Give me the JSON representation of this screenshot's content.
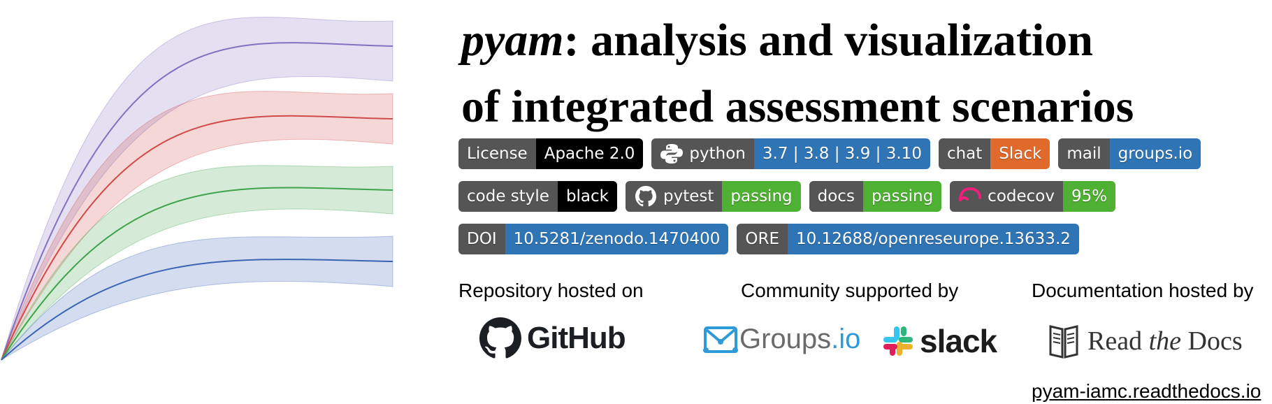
{
  "title": {
    "package": "pyam",
    "line1_rest": ": analysis and visualization",
    "line2": "of integrated assessment scenarios"
  },
  "band_colors": [
    "#8470c0",
    "#d04a4a",
    "#3ea34a",
    "#3a64b4"
  ],
  "badges": [
    [
      {
        "label": "License",
        "value": "Apache 2.0",
        "color": "#000000"
      },
      {
        "icon": "python-icon",
        "label": "python",
        "value": "3.7 | 3.8 | 3.9 | 3.10",
        "color": "#2f75b5"
      },
      {
        "label": "chat",
        "value": "Slack",
        "color": "#e06a2c"
      },
      {
        "label": "mail",
        "value": "groups.io",
        "color": "#2f75b5"
      }
    ],
    [
      {
        "label": "code style",
        "value": "black",
        "color": "#000000"
      },
      {
        "icon": "github-icon",
        "label": "pytest",
        "value": "passing",
        "color": "#4fb133"
      },
      {
        "label": "docs",
        "value": "passing",
        "color": "#4fb133"
      },
      {
        "icon": "codecov-icon",
        "label": "codecov",
        "value": "95%",
        "color": "#4fb133"
      }
    ],
    [
      {
        "label": "DOI",
        "value": "10.5281/zenodo.1470400",
        "color": "#2f75b5"
      },
      {
        "label": "ORE",
        "value": "10.12688/openreseurope.13633.2",
        "color": "#2f75b5"
      }
    ]
  ],
  "sections": {
    "repo": "Repository hosted on",
    "community": "Community supported by",
    "docs": "Documentation hosted by"
  },
  "logos": {
    "github": "GitHub",
    "groups_a": "Groups",
    "groups_b": ".io",
    "slack": "slack",
    "rtd_a": "Read ",
    "rtd_b": "the",
    "rtd_c": " Docs"
  },
  "docs_link": "pyam-iamc.readthedocs.io"
}
